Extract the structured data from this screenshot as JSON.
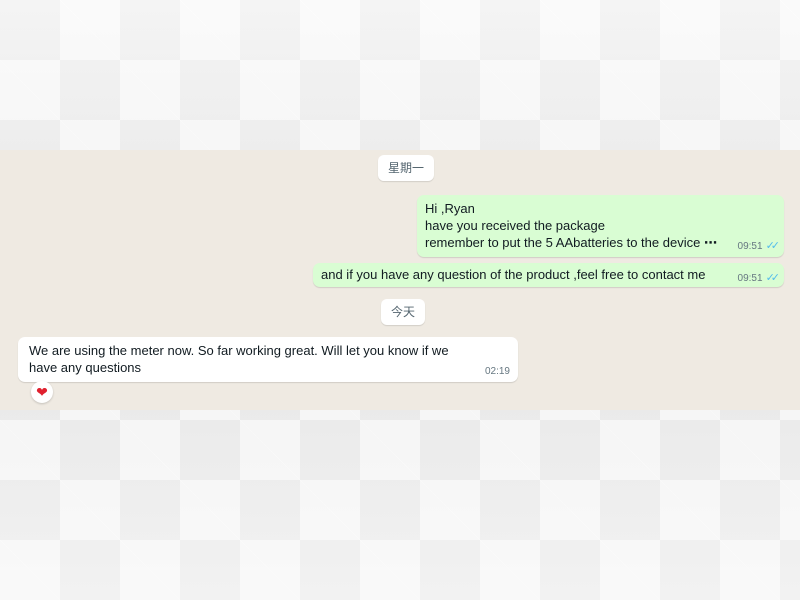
{
  "chat": {
    "date_separators": [
      "星期一",
      "今天"
    ],
    "messages": [
      {
        "direction": "outgoing",
        "lines": [
          "Hi ,Ryan",
          "have you received the package",
          "remember to put the 5 AAbatteries to the device"
        ],
        "time": "09:51",
        "status": "read"
      },
      {
        "direction": "outgoing",
        "lines": [
          "and if you have any question of the product ,feel free to contact me"
        ],
        "time": "09:51",
        "status": "read"
      },
      {
        "direction": "incoming",
        "lines": [
          "We are using the meter now.  So far working great.  Will let you know if we",
          "have any questions"
        ],
        "time": "02:19",
        "reaction": "heart"
      }
    ]
  },
  "icons": {
    "read_receipt": "double-check-icon",
    "reaction": "red-heart-icon"
  },
  "colors": {
    "chat_background": "#efeae2",
    "outgoing_bubble": "#d9fdd3",
    "incoming_bubble": "#ffffff",
    "read_tick": "#53bdeb",
    "reaction_heart": "#e0202e"
  }
}
